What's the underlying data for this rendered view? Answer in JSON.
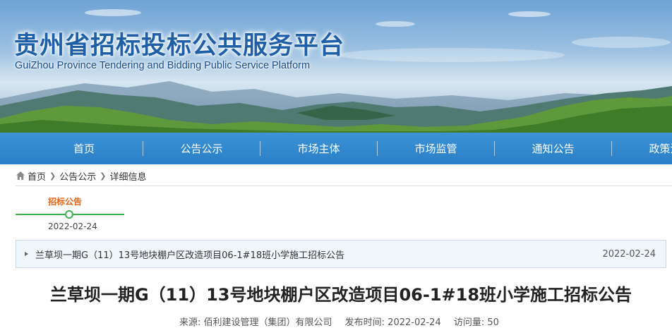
{
  "header": {
    "title": "贵州省招标投标公共服务平台",
    "subtitle": "GuiZhou Province Tendering and Bidding Public Service Platform"
  },
  "nav": {
    "items": [
      "首页",
      "公告公示",
      "市场主体",
      "市场监管",
      "通知公告",
      "政策法规"
    ]
  },
  "breadcrumb": {
    "home": "首页",
    "level1": "公告公示",
    "level2": "详细信息"
  },
  "timeline": {
    "label": "招标公告",
    "date": "2022-02-24"
  },
  "notice": {
    "title": "兰草坝一期G（11）13号地块棚户区改造项目06-1#18班小学施工招标公告",
    "date": "2022-02-24"
  },
  "article": {
    "title": "兰草坝一期G（11）13号地块棚户区改造项目06-1#18班小学施工招标公告",
    "source": "来源: 佰利建设管理（集团）有限公司",
    "publish_time": "发布时间: 2022-02-24",
    "visits": "访问量: 50"
  },
  "colors": {
    "nav_bg": "#2a7fc6",
    "title_blue": "#1e5fa8",
    "timeline_green": "#3bb34a",
    "timeline_label": "#e26518"
  }
}
